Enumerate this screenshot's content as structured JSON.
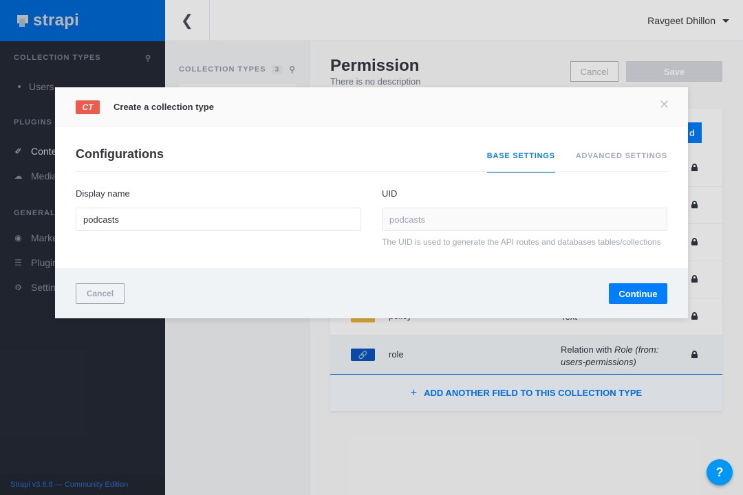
{
  "sidebar": {
    "brand": "strapi",
    "collection_types_head": "COLLECTION TYPES",
    "collection_items": [
      {
        "label": "Users"
      }
    ],
    "plugins_head": "PLUGINS",
    "plugin_items": [
      {
        "label": "Content-Types Builder"
      },
      {
        "label": "Media Library"
      }
    ],
    "general_head": "GENERAL",
    "general_items": [
      {
        "label": "Marketplace"
      },
      {
        "label": "Plugins"
      },
      {
        "label": "Settings"
      }
    ],
    "footer": "Strapi v3.6.8 — Community Edition"
  },
  "header": {
    "user_name": "Ravgeet Dhillon"
  },
  "mid_panel": {
    "head": "COLLECTION TYPES",
    "count": "3"
  },
  "main": {
    "title": "Permission",
    "description": "There is no description",
    "cancel_label": "Cancel",
    "save_label": "Save",
    "add_btn_fragment": "d",
    "fields": [
      {
        "name": "policy",
        "type": "Text",
        "icon": "Ab"
      },
      {
        "name": "role",
        "type_prefix": "Relation with ",
        "type_em": "Role (from: users-permissions)"
      }
    ],
    "add_field_label": "ADD ANOTHER FIELD TO THIS COLLECTION TYPE",
    "help_label": "?"
  },
  "modal": {
    "badge": "CT",
    "title": "Create a collection type",
    "config_title": "Configurations",
    "tabs": [
      {
        "label": "BASE SETTINGS"
      },
      {
        "label": "ADVANCED SETTINGS"
      }
    ],
    "display_name_label": "Display name",
    "display_name_value": "podcasts",
    "uid_label": "UID",
    "uid_value": "podcasts",
    "uid_help": "The UID is used to generate the API routes and databases tables/collections",
    "cancel_label": "Cancel",
    "continue_label": "Continue"
  },
  "colors": {
    "primary": "#007eff",
    "sidebar_bg": "#2e3443",
    "badge": "#ef5a4b",
    "text_icon": "#f4b537",
    "relation_icon": "#0c52c1"
  }
}
